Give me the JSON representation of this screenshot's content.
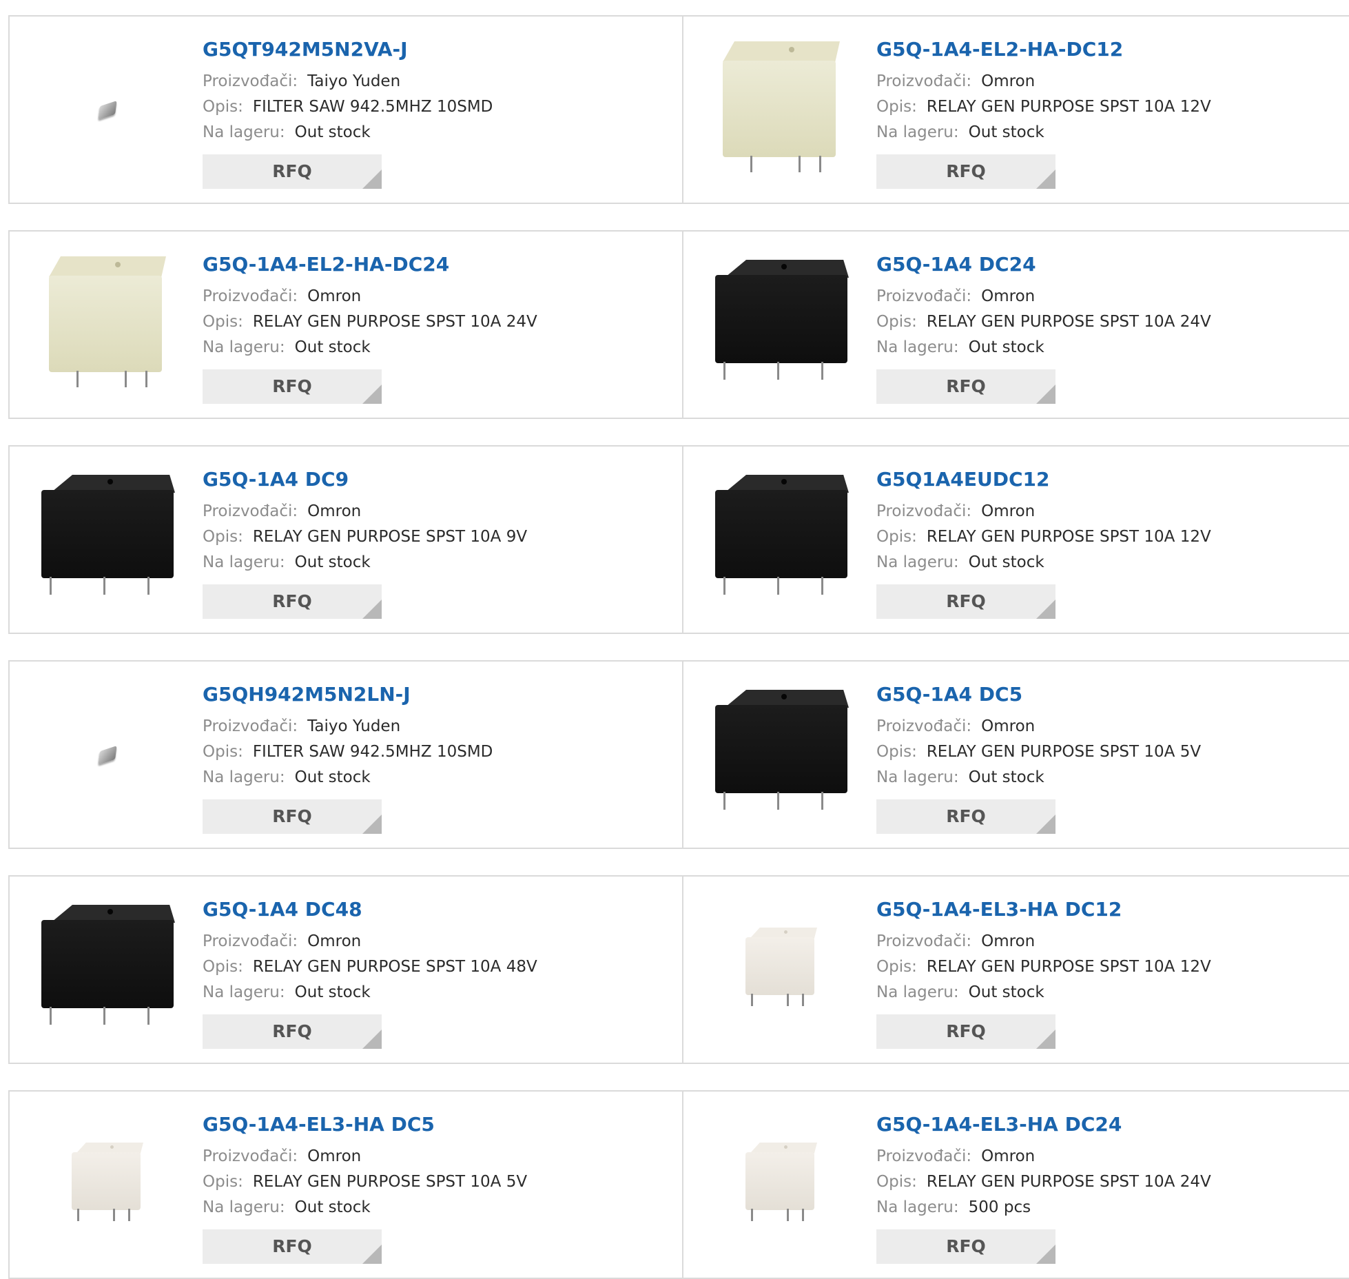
{
  "labels": {
    "manufacturer": "Proizvođači:",
    "description": "Opis:",
    "stock": "Na lageru:",
    "rfq_button": "RFQ"
  },
  "products": [
    {
      "name": "G5QT942M5N2VA-J",
      "manufacturer": "Taiyo Yuden",
      "description": "FILTER SAW 942.5MHZ 10SMD",
      "stock": "Out stock",
      "image": "saw-filter-chip"
    },
    {
      "name": "G5Q-1A4-EL2-HA-DC12",
      "manufacturer": "Omron",
      "description": "RELAY GEN PURPOSE SPST 10A 12V",
      "stock": "Out stock",
      "image": "cream-relay"
    },
    {
      "name": "G5Q-1A4-EL2-HA-DC24",
      "manufacturer": "Omron",
      "description": "RELAY GEN PURPOSE SPST 10A 24V",
      "stock": "Out stock",
      "image": "cream-relay"
    },
    {
      "name": "G5Q-1A4 DC24",
      "manufacturer": "Omron",
      "description": "RELAY GEN PURPOSE SPST 10A 24V",
      "stock": "Out stock",
      "image": "black-relay"
    },
    {
      "name": "G5Q-1A4 DC9",
      "manufacturer": "Omron",
      "description": "RELAY GEN PURPOSE SPST 10A 9V",
      "stock": "Out stock",
      "image": "black-relay"
    },
    {
      "name": "G5Q1A4EUDC12",
      "manufacturer": "Omron",
      "description": "RELAY GEN PURPOSE SPST 10A 12V",
      "stock": "Out stock",
      "image": "black-relay"
    },
    {
      "name": "G5QH942M5N2LN-J",
      "manufacturer": "Taiyo Yuden",
      "description": "FILTER SAW 942.5MHZ 10SMD",
      "stock": "Out stock",
      "image": "saw-filter-chip"
    },
    {
      "name": "G5Q-1A4 DC5",
      "manufacturer": "Omron",
      "description": "RELAY GEN PURPOSE SPST 10A 5V",
      "stock": "Out stock",
      "image": "black-relay"
    },
    {
      "name": "G5Q-1A4 DC48",
      "manufacturer": "Omron",
      "description": "RELAY GEN PURPOSE SPST 10A 48V",
      "stock": "Out stock",
      "image": "black-relay"
    },
    {
      "name": "G5Q-1A4-EL3-HA DC12",
      "manufacturer": "Omron",
      "description": "RELAY GEN PURPOSE SPST 10A 12V",
      "stock": "Out stock",
      "image": "white-relay"
    },
    {
      "name": "G5Q-1A4-EL3-HA DC5",
      "manufacturer": "Omron",
      "description": "RELAY GEN PURPOSE SPST 10A 5V",
      "stock": "Out stock",
      "image": "white-relay"
    },
    {
      "name": "G5Q-1A4-EL3-HA DC24",
      "manufacturer": "Omron",
      "description": "RELAY GEN PURPOSE SPST 10A 24V",
      "stock": "500 pcs",
      "image": "white-relay"
    }
  ]
}
